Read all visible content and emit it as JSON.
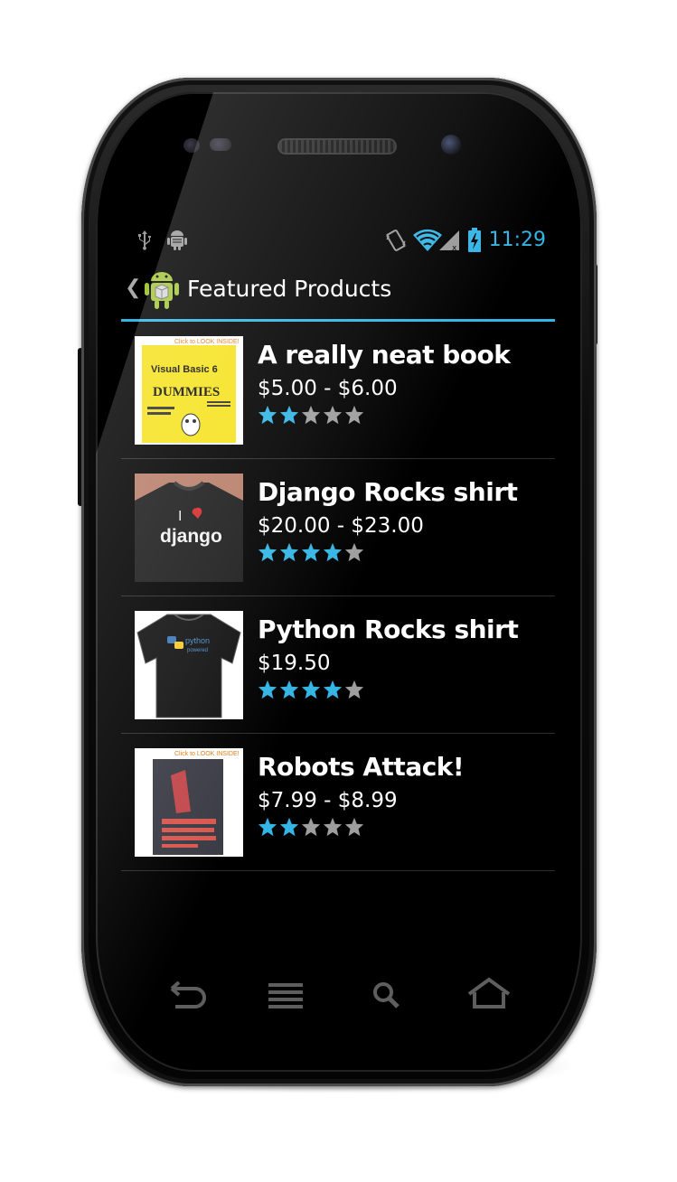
{
  "status_bar": {
    "time": "11:29",
    "icons": [
      "usb-icon",
      "android-debug-icon",
      "vibrate-icon",
      "wifi-icon",
      "signal-icon",
      "battery-charging-icon"
    ]
  },
  "action_bar": {
    "title": "Featured Products",
    "app_icon": "android-package-icon",
    "up_icon": "chevron-left-icon"
  },
  "products": [
    {
      "name": "A really neat book",
      "price": "$5.00 - $6.00",
      "rating": 2,
      "max_rating": 5,
      "image": "book-cover-visual-basic"
    },
    {
      "name": "Django Rocks shirt",
      "price": "$20.00 - $23.00",
      "rating": 4,
      "max_rating": 5,
      "image": "django-shirt"
    },
    {
      "name": "Python Rocks shirt",
      "price": "$19.50",
      "rating": 4,
      "max_rating": 5,
      "image": "python-shirt"
    },
    {
      "name": "Robots Attack!",
      "price": "$7.99 - $8.99",
      "rating": 2,
      "max_rating": 5,
      "image": "robot-book-cover"
    }
  ],
  "thumb_text": {
    "book1_banner": "Click to LOOK INSIDE!",
    "book1_title": "Visual Basic 6",
    "book1_dummies": "DUMMIES",
    "django_love": "I",
    "django_word": "django",
    "python_word": "python",
    "python_sub": "powered",
    "book2_banner": "Click to LOOK INSIDE!"
  },
  "navbar": [
    "back-icon",
    "menu-icon",
    "search-icon",
    "home-icon"
  ],
  "colors": {
    "accent": "#33b5e5",
    "background": "#000000",
    "star_off": "#9e9e9e"
  }
}
